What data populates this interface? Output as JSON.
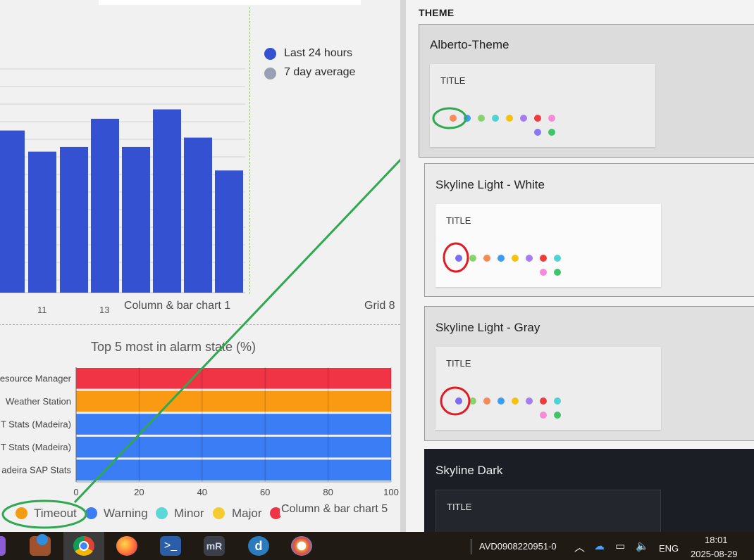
{
  "dashboard": {
    "column_chart": {
      "caption": "Column & bar chart 1",
      "x_ticks": [
        "11",
        "13"
      ],
      "legend": [
        {
          "label": "Last 24 hours",
          "color": "#3451d1"
        },
        {
          "label": "7 day average",
          "color": "#9aa0b4"
        }
      ]
    },
    "grid_caption": "Grid 8",
    "bar_chart": {
      "caption": "Column & bar chart 5",
      "legend": [
        {
          "label": "Timeout",
          "color": "#f39c12"
        },
        {
          "label": "Warning",
          "color": "#3b7df5"
        },
        {
          "label": "Minor",
          "color": "#5ad8d8"
        },
        {
          "label": "Major",
          "color": "#f4cc30"
        }
      ]
    }
  },
  "chart_data": [
    {
      "type": "bar",
      "title": "",
      "series": [
        {
          "name": "Last 24 hours",
          "values": [
            69,
            60,
            62,
            74,
            62,
            78,
            66,
            52
          ]
        }
      ],
      "ylim": [
        0,
        100
      ],
      "grid": true,
      "legend_position": "right"
    },
    {
      "type": "bar",
      "orientation": "horizontal",
      "title": "Top 5 most in alarm state (%)",
      "categories": [
        "esource Manager",
        "Weather Station",
        "T Stats (Madeira)",
        "T Stats (Madeira)",
        "adeira SAP Stats"
      ],
      "series": [
        {
          "name": "",
          "values": [
            100,
            100,
            100,
            100,
            100
          ]
        }
      ],
      "bar_colors": [
        "#f13346",
        "#fa9a12",
        "#3b7df5",
        "#3b7df5",
        "#3b7df5"
      ],
      "x_ticks": [
        "0",
        "20",
        "40",
        "60",
        "80",
        "100"
      ],
      "xlim": [
        0,
        100
      ],
      "grid": true,
      "legend_position": "bottom"
    }
  ],
  "theme_panel": {
    "heading": "THEME",
    "themes": [
      {
        "name": "Alberto-Theme",
        "preview_title": "TITLE",
        "dots": [
          "#f68a54",
          "#3b9cf5",
          "#88d46a",
          "#4fd2d4",
          "#f4c20d",
          "#a57df0",
          "#ef3b3b",
          "#f78bd7"
        ],
        "dots_row2": [
          "#8a78f0",
          "#3fc46a"
        ]
      },
      {
        "name": "Skyline Light - White",
        "preview_title": "TITLE",
        "dots": [
          "#7b6cf2",
          "#88d46a",
          "#f68a54",
          "#3b9cf5",
          "#f4c20d",
          "#a57df0",
          "#ef3b3b",
          "#4fd2d4"
        ],
        "dots_row2": [
          "#f78bd7",
          "#3fc46a"
        ]
      },
      {
        "name": "Skyline Light - Gray",
        "preview_title": "TITLE",
        "dots": [
          "#7b6cf2",
          "#88d46a",
          "#f68a54",
          "#3b9cf5",
          "#f4c20d",
          "#a57df0",
          "#ef3b3b",
          "#4fd2d4"
        ],
        "dots_row2": [
          "#f78bd7",
          "#3fc46a"
        ]
      },
      {
        "name": "Skyline Dark",
        "preview_title": "TITLE",
        "dots": [],
        "dots_row2": []
      }
    ]
  },
  "taskbar": {
    "apps": [
      "visual-studio-icon",
      "network-app-icon",
      "chrome-icon",
      "firefox-icon",
      "powershell-icon",
      "mremoteng-icon",
      "dataminer-icon",
      "paint-icon"
    ],
    "host": "AVD0908220951-0",
    "language": "ENG",
    "time": "18:01",
    "date": "2025-08-29"
  }
}
